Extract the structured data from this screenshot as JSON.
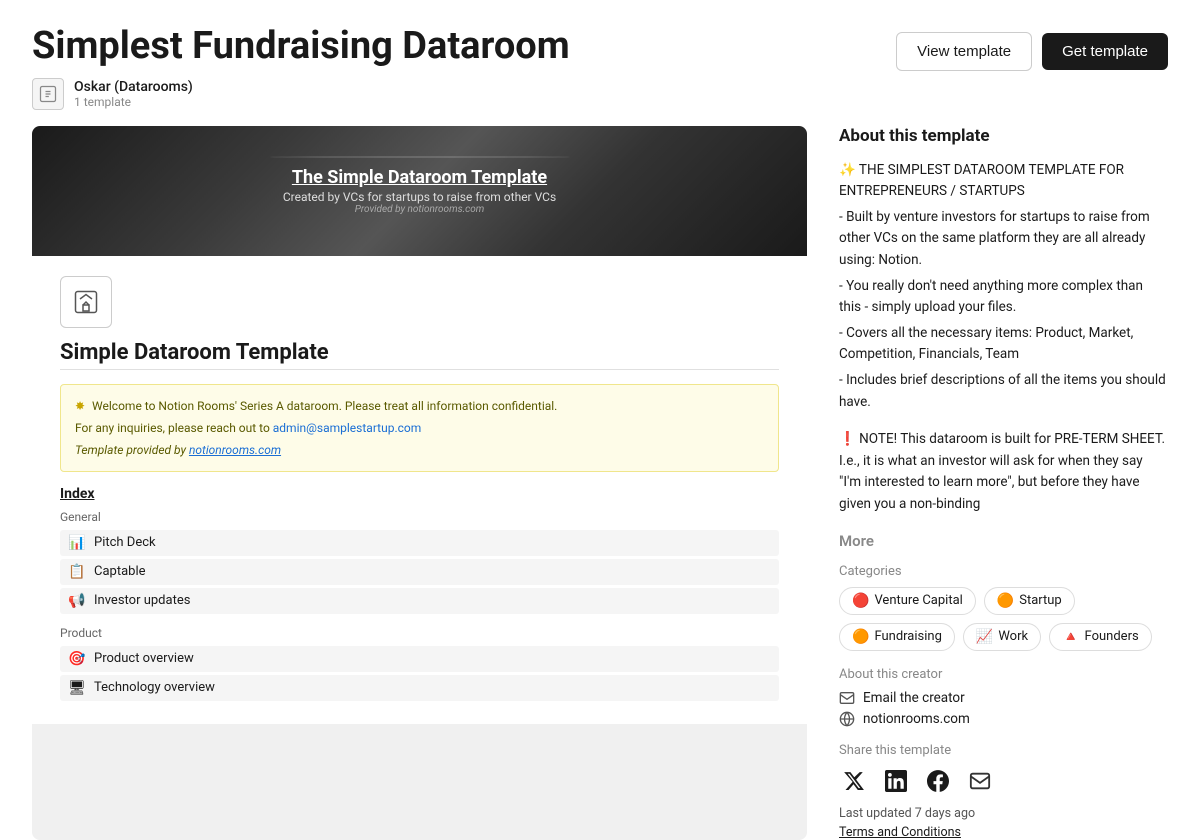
{
  "header": {
    "title": "Simplest Fundraising Dataroom",
    "creator": {
      "name": "Oskar (Datarooms)",
      "template_count": "1 template"
    },
    "buttons": {
      "view_template": "View template",
      "get_template": "Get template"
    }
  },
  "preview": {
    "banner": {
      "title": "The Simple Dataroom Template",
      "subtitle": "Created by VCs for startups to raise from other VCs",
      "provided": "Provided by notionrooms.com"
    },
    "doc_title": "Simple Dataroom Template",
    "notice": {
      "line1": "Welcome to Notion Rooms' Series A dataroom. Please treat all information confidential.",
      "line2_prefix": "For any inquiries, please reach out to ",
      "line2_email": "admin@samplestartup.com",
      "line3_prefix": "Template provided by ",
      "line3_link": "notionrooms.com"
    },
    "index_label": "Index",
    "general_label": "General",
    "items_general": [
      {
        "icon": "📊",
        "label": "Pitch Deck"
      },
      {
        "icon": "📋",
        "label": "Captable"
      },
      {
        "icon": "📢",
        "label": "Investor updates"
      }
    ],
    "product_label": "Product",
    "items_product": [
      {
        "icon": "🎯",
        "label": "Product overview"
      },
      {
        "icon": "🖥",
        "label": "Technology overview"
      }
    ]
  },
  "about": {
    "title": "About this template",
    "description_lines": [
      "✨  THE SIMPLEST DATAROOM TEMPLATE FOR ENTREPRENEURS / STARTUPS",
      "- Built by venture investors for startups to raise from other VCs on the same platform they are all already using: Notion.",
      "- You really don't need anything more complex than this - simply upload your files.",
      "- Covers all the necessary items: Product, Market, Competition, Financials, Team",
      "- Includes brief descriptions of all the items you should have."
    ],
    "note": "❗ NOTE! This dataroom is built for PRE-TERM SHEET. I.e., it is what an investor will ask for when they say \"I'm interested to learn more\", but before they have given you a non-binding",
    "more_label": "More",
    "categories_label": "Categories",
    "categories": [
      {
        "emoji": "🔴",
        "label": "Venture Capital"
      },
      {
        "emoji": "🟠",
        "label": "Startup"
      },
      {
        "emoji": "🟠",
        "label": "Fundraising"
      },
      {
        "emoji": "📈",
        "label": "Work"
      },
      {
        "emoji": "🔺",
        "label": "Founders"
      }
    ],
    "about_creator_label": "About this creator",
    "email_creator": "Email the creator",
    "website": "notionrooms.com",
    "share_label": "Share this template",
    "last_updated": "Last updated 7 days ago",
    "terms": "Terms and Conditions"
  }
}
